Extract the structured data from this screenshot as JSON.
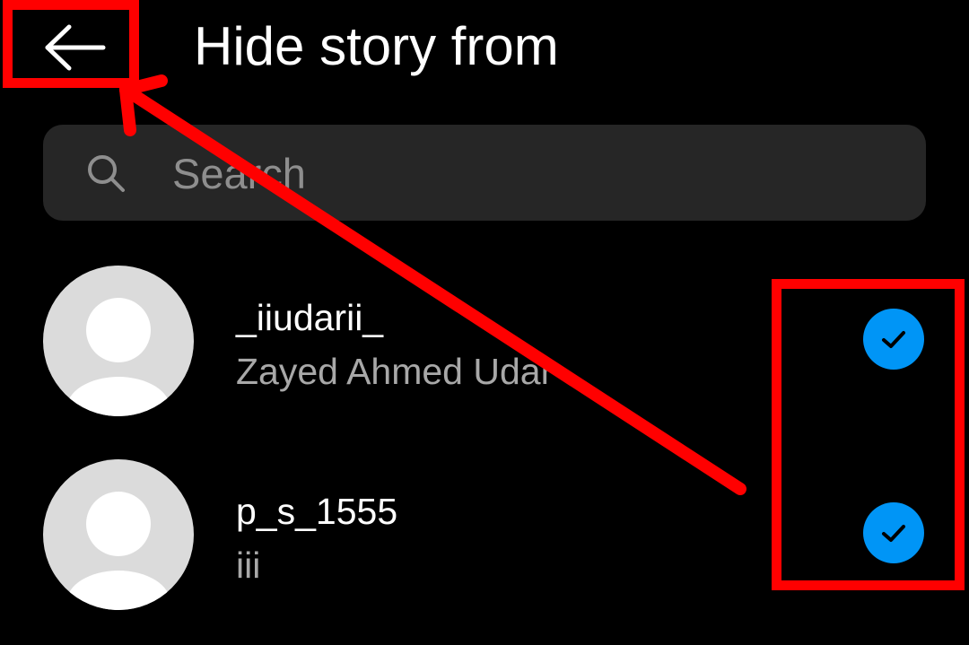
{
  "header": {
    "title": "Hide story from",
    "back_icon": "arrow-left-icon"
  },
  "search": {
    "placeholder": "Search",
    "icon": "search-icon"
  },
  "users": [
    {
      "username": "_iiudarii_",
      "full_name": "Zayed Ahmed Udar",
      "selected": true
    },
    {
      "username": "p_s_1555",
      "full_name": "iii",
      "selected": true
    }
  ],
  "colors": {
    "background": "#000000",
    "search_bg": "#262626",
    "check_blue": "#0095f6",
    "annotation_red": "#ff0000",
    "secondary_text": "#a8a8a8",
    "avatar_bg": "#dbdbdb"
  }
}
